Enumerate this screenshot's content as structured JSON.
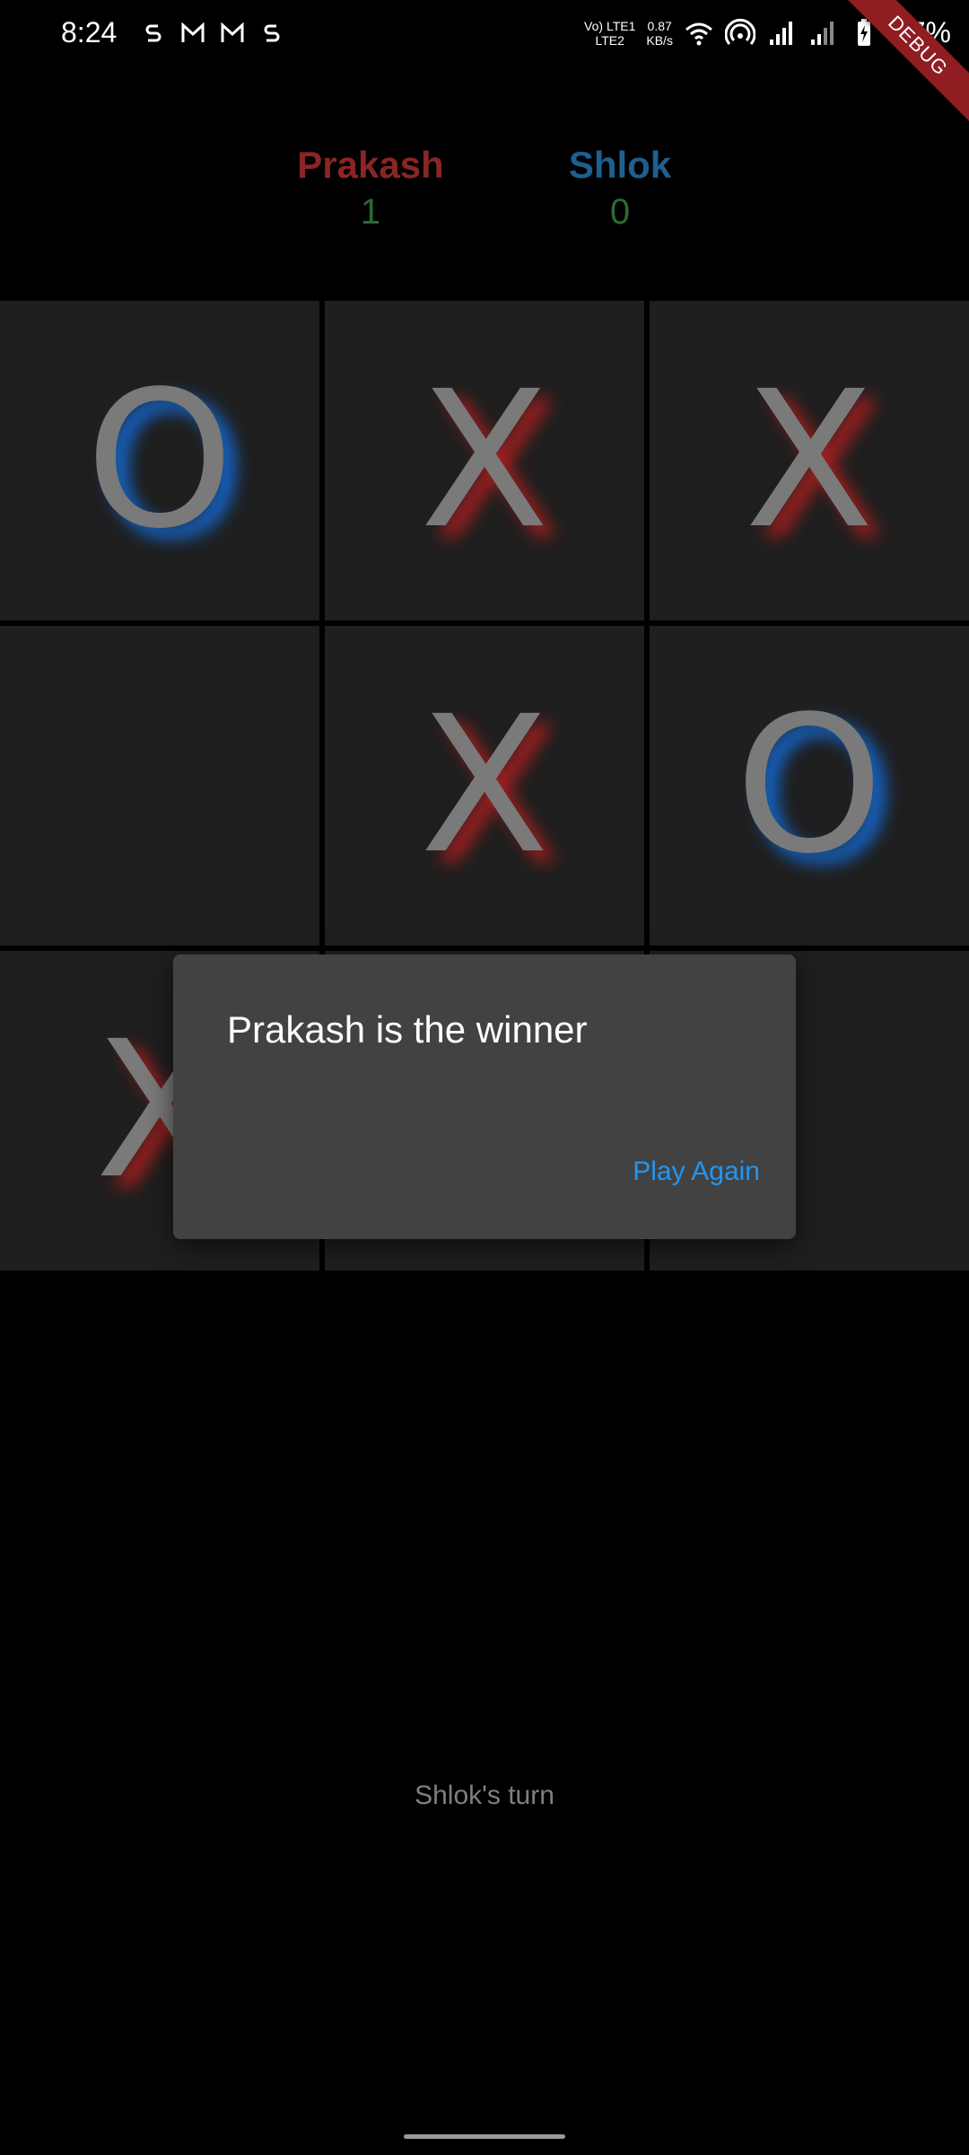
{
  "status_bar": {
    "time": "8:24",
    "notification_icons": [
      "s-icon",
      "gmail-icon",
      "gmail-icon",
      "s-icon"
    ],
    "network_label_top": "Vo) LTE1",
    "network_label_bottom": "LTE2",
    "speed_value": "0.87",
    "speed_unit": "KB/s",
    "battery_percent": "87%"
  },
  "debug_banner": "DEBUG",
  "players": [
    {
      "name": "Prakash",
      "score": "1",
      "color": "#8a2525"
    },
    {
      "name": "Shlok",
      "score": "0",
      "color": "#1d5f8e"
    }
  ],
  "board": [
    "O",
    "X",
    "X",
    "",
    "X",
    "O",
    "X",
    "",
    ""
  ],
  "dialog": {
    "title": "Prakash is the winner",
    "action": "Play Again"
  },
  "turn_text": "Shlok's turn",
  "colors": {
    "x_glow": "#be1e1e",
    "o_glow": "#146edc",
    "accent": "#2196f3"
  }
}
